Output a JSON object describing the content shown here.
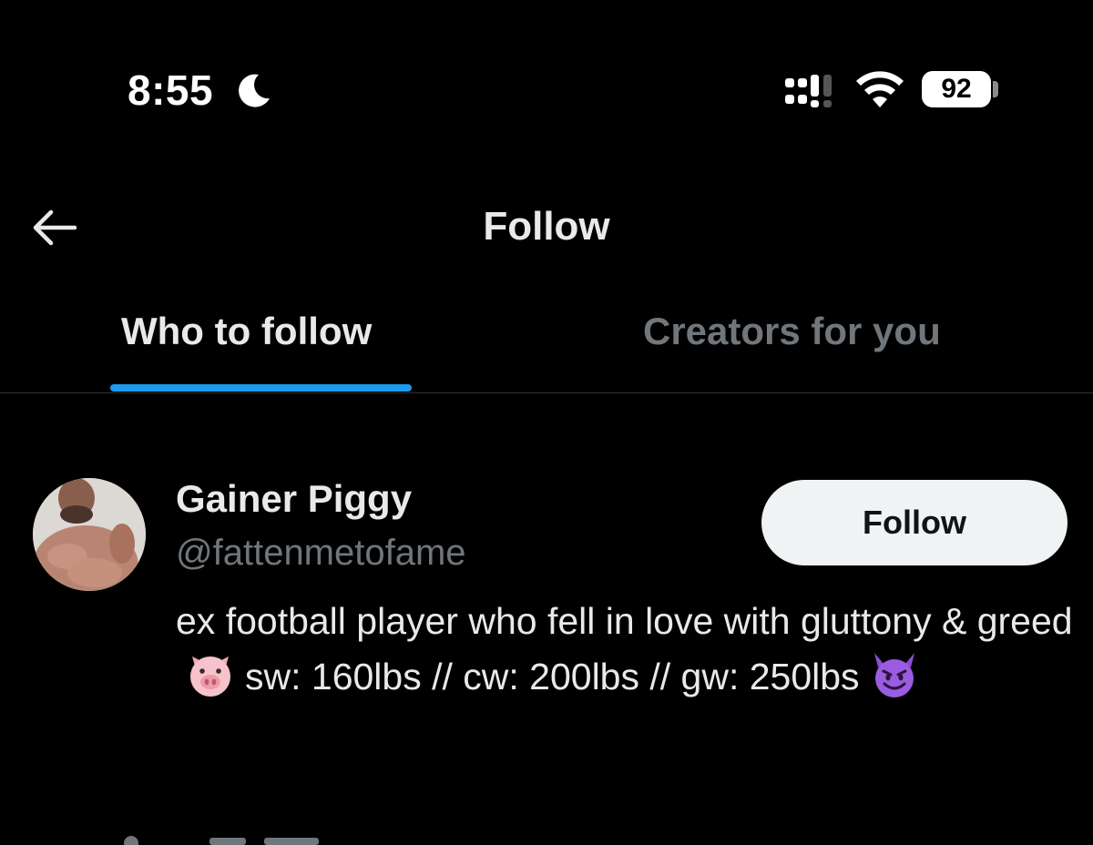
{
  "status_bar": {
    "time": "8:55",
    "battery": "92",
    "icons": [
      "moon-icon",
      "signal-icon",
      "wifi-icon",
      "battery-icon"
    ]
  },
  "header": {
    "title": "Follow",
    "back_icon": "arrow-left-icon"
  },
  "tabs": [
    {
      "label": "Who to follow",
      "active": true
    },
    {
      "label": "Creators for you",
      "active": false
    }
  ],
  "accent_color": "#1d9bf0",
  "user_card": {
    "name": "Gainer Piggy",
    "handle": "@fattenmetofame",
    "follow_label": "Follow",
    "bio_part1": "ex football player who fell in love with gluttony & greed",
    "bio_emoji1": "pig-face-emoji",
    "bio_part2": "sw: 160lbs // cw: 200lbs // gw: 250lbs",
    "bio_emoji2": "smiling-devil-emoji"
  }
}
